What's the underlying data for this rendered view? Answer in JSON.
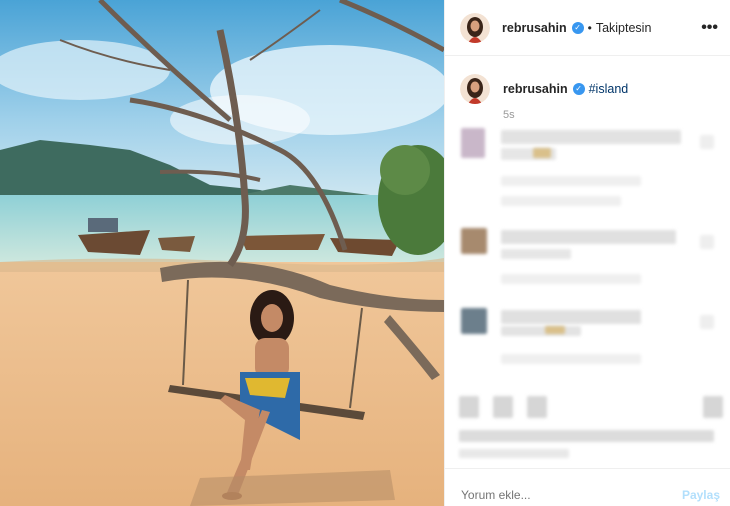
{
  "post": {
    "author": "rebrusahin",
    "follow_status": "Takiptesin",
    "separator": "•",
    "caption_hashtag": "#island",
    "time_ago": "5s",
    "more_icon": "more-horizontal-icon",
    "verified_icon": "verified-badge-icon"
  },
  "comment_box": {
    "placeholder": "Yorum ekle...",
    "share_label": "Paylaş"
  },
  "colors": {
    "link": "#003569",
    "verified": "#3897f0",
    "share_disabled": "#b2dffc",
    "muted": "#999999"
  }
}
